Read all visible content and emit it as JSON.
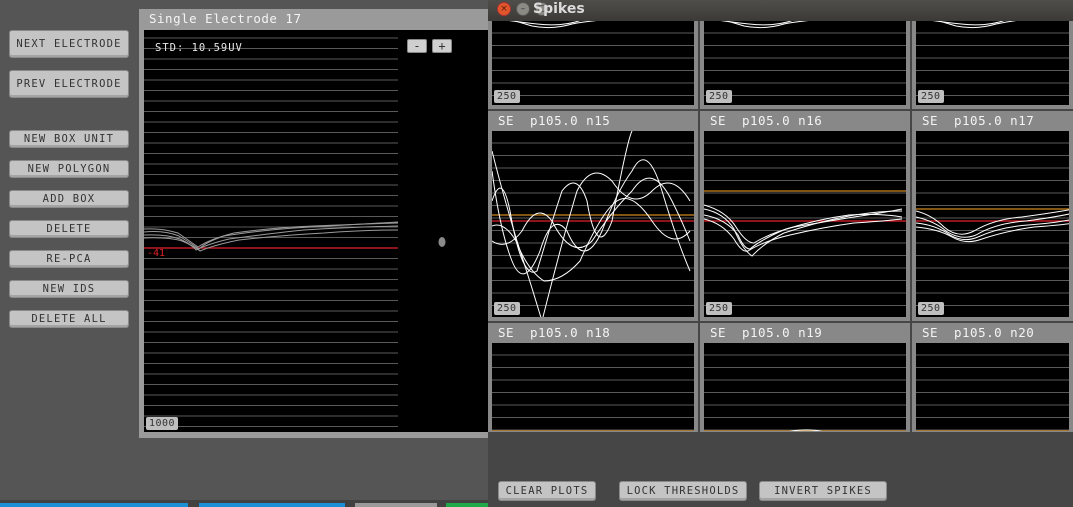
{
  "left_panel": {
    "buttons": [
      {
        "name": "next-electrode-button",
        "label": "NEXT ELECTRODE"
      },
      {
        "name": "prev-electrode-button",
        "label": "PREV ELECTRODE"
      },
      {
        "name": "new-box-unit-button",
        "label": "NEW BOX UNIT"
      },
      {
        "name": "new-polygon-button",
        "label": "NEW POLYGON"
      },
      {
        "name": "add-box-button",
        "label": "ADD BOX"
      },
      {
        "name": "delete-button",
        "label": "DELETE"
      },
      {
        "name": "re-pca-button",
        "label": "RE-PCA"
      },
      {
        "name": "new-ids-button",
        "label": "NEW IDS"
      },
      {
        "name": "delete-all-button",
        "label": "DELETE ALL"
      }
    ]
  },
  "single_electrode": {
    "title": "Single Electrode 17",
    "std_label": "STD: 10.59UV",
    "threshold_label": "-41",
    "scale_label": "1000",
    "zoom_out_label": "-",
    "zoom_in_label": "+"
  },
  "spikes_window": {
    "title": "Spikes",
    "close_glyph": "×",
    "minimize_glyph": "–",
    "maximize_glyph": "□",
    "top_row_scales": [
      "250",
      "250",
      "250"
    ],
    "cells": [
      {
        "se": "SE",
        "label": "p105.0 n15",
        "scale": "250"
      },
      {
        "se": "SE",
        "label": "p105.0 n16",
        "scale": "250"
      },
      {
        "se": "SE",
        "label": "p105.0 n17",
        "scale": "250"
      },
      {
        "se": "SE",
        "label": "p105.0 n18",
        "scale": ""
      },
      {
        "se": "SE",
        "label": "p105.0 n19",
        "scale": ""
      },
      {
        "se": "SE",
        "label": "p105.0 n20",
        "scale": ""
      }
    ],
    "bottom_buttons": {
      "clear_plots": "CLEAR PLOTS",
      "lock_thresholds": "LOCK THRESHOLDS",
      "invert_spikes": "INVERT SPIKES"
    }
  },
  "colors": {
    "threshold_red": "#e0202a",
    "threshold_orange": "#d08a1c",
    "trace_white": "#ffffff",
    "taskbar_blue": "#1a8fd6",
    "taskbar_green": "#1fa84a"
  }
}
